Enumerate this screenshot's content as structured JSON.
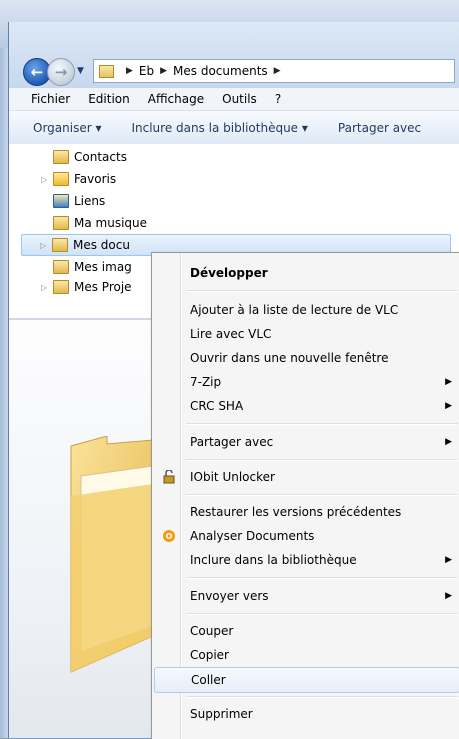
{
  "address": {
    "crumbs": [
      "Eb",
      "Mes documents"
    ]
  },
  "menubar": {
    "items": [
      "Fichier",
      "Edition",
      "Affichage",
      "Outils",
      "?"
    ]
  },
  "toolbar": {
    "organize": "Organiser ▾",
    "include": "Inclure dans la bibliothèque ▾",
    "share": "Partager avec"
  },
  "tree": {
    "items": [
      {
        "label": "Contacts"
      },
      {
        "label": "Favoris"
      },
      {
        "label": "Liens"
      },
      {
        "label": "Ma musique"
      },
      {
        "label": "Mes docu"
      },
      {
        "label": "Mes imag"
      },
      {
        "label": "Mes Proje"
      }
    ]
  },
  "context_menu": {
    "items": [
      {
        "label": "Développer"
      },
      {
        "label": "Ajouter à la liste de lecture de VLC"
      },
      {
        "label": "Lire avec VLC"
      },
      {
        "label": "Ouvrir dans une nouvelle fenêtre"
      },
      {
        "label": "7-Zip"
      },
      {
        "label": "CRC SHA"
      },
      {
        "label": "Partager avec"
      },
      {
        "label": "IObit Unlocker"
      },
      {
        "label": "Restaurer les versions précédentes"
      },
      {
        "label": "Analyser Documents"
      },
      {
        "label": "Inclure dans la bibliothèque"
      },
      {
        "label": "Envoyer vers"
      },
      {
        "label": "Couper"
      },
      {
        "label": "Copier"
      },
      {
        "label": "Coller"
      },
      {
        "label": "Supprimer"
      }
    ]
  },
  "colors": {
    "selection": "#cce0f7",
    "menu_bg": "#f5f5f5",
    "folder": "#f0c75e"
  },
  "icons": {
    "back": "arrow-left-icon",
    "forward": "arrow-right-icon",
    "iobit": "lock-icon",
    "analyze": "orange-circle-icon"
  }
}
